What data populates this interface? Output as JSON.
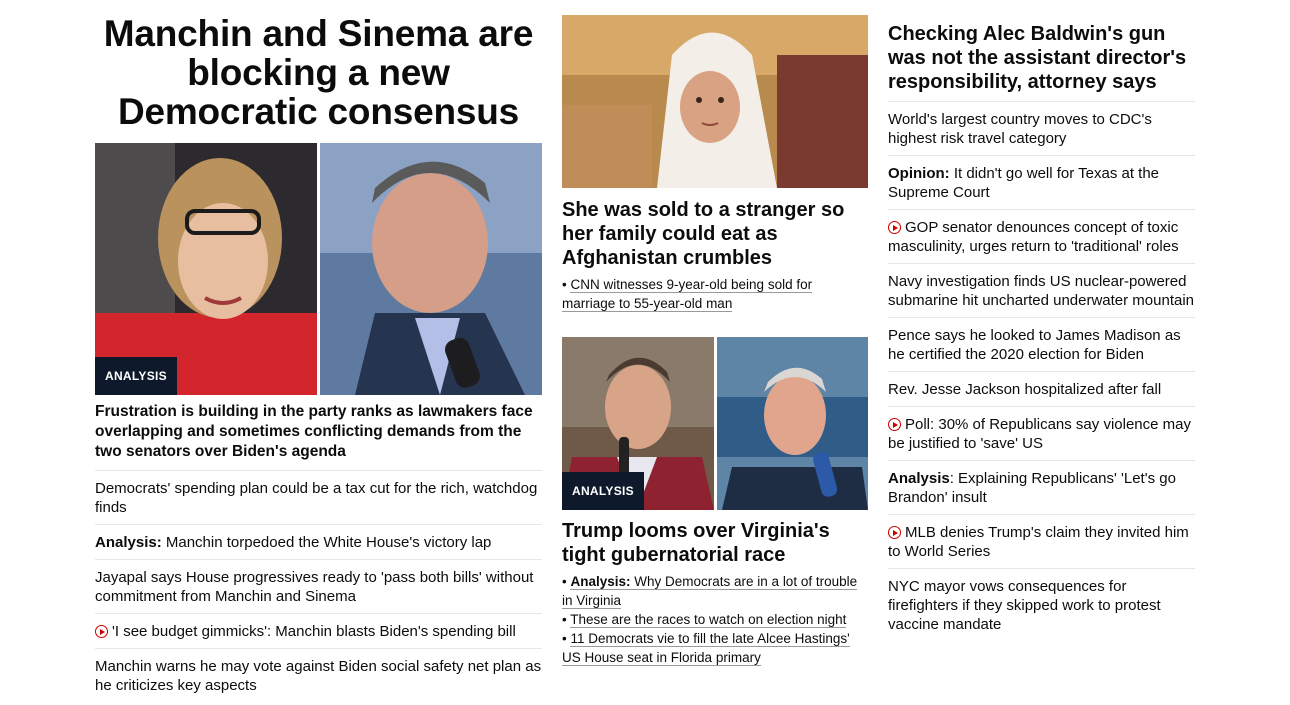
{
  "lead": {
    "headline": "Manchin and Sinema are blocking a new Democratic consensus",
    "badge": "ANALYSIS",
    "subheadline": "Frustration is building in the party ranks as lawmakers face overlapping and sometimes conflicting demands from the two senators over Biden's agenda",
    "links": [
      {
        "prefix": "",
        "text": "Democrats' spending plan could be a tax cut for the rich, watchdog finds",
        "video": false
      },
      {
        "prefix": "Analysis:",
        "text": " Manchin torpedoed the White House's victory lap",
        "video": false
      },
      {
        "prefix": "",
        "text": "Jayapal says House progressives ready to 'pass both bills' without commitment from Manchin and Sinema",
        "video": false
      },
      {
        "prefix": "",
        "text": "'I see budget gimmicks': Manchin blasts Biden's spending bill",
        "video": true
      },
      {
        "prefix": "",
        "text": "Manchin warns he may vote against Biden social safety net plan as he criticizes key aspects",
        "video": false
      }
    ]
  },
  "afghan": {
    "headline": "She was sold to a stranger so her family could eat as Afghanistan crumbles",
    "bullets": [
      {
        "prefix": "",
        "text": "CNN witnesses 9-year-old being sold for marriage to 55-year-old man"
      }
    ]
  },
  "virginia": {
    "badge": "ANALYSIS",
    "headline": "Trump looms over Virginia's tight gubernatorial race",
    "bullets": [
      {
        "prefix": "Analysis:",
        "text": " Why Democrats are in a lot of trouble in Virginia"
      },
      {
        "prefix": "",
        "text": "These are the races to watch on election night"
      },
      {
        "prefix": "",
        "text": "11 Democrats vie to fill the late Alcee Hastings' US House seat in Florida primary"
      }
    ]
  },
  "right": {
    "headline": "Checking Alec Baldwin's gun was not the assistant director's responsibility, attorney says",
    "links": [
      {
        "prefix": "",
        "text": "World's largest country moves to CDC's highest risk travel category",
        "video": false
      },
      {
        "prefix": "Opinion:",
        "text": " It didn't go well for Texas at the Supreme Court",
        "video": false
      },
      {
        "prefix": "",
        "text": "GOP senator denounces concept of toxic masculinity, urges return to 'traditional' roles",
        "video": true
      },
      {
        "prefix": "",
        "text": "Navy investigation finds US nuclear-powered submarine hit uncharted underwater mountain",
        "video": false
      },
      {
        "prefix": "",
        "text": "Pence says he looked to James Madison as he certified the 2020 election for Biden",
        "video": false
      },
      {
        "prefix": "",
        "text": "Rev. Jesse Jackson hospitalized after fall",
        "video": false
      },
      {
        "prefix": "",
        "text": "Poll: 30% of Republicans say violence may be justified to 'save' US",
        "video": true
      },
      {
        "prefix": "Analysis",
        "text": ": Explaining Republicans' 'Let's go Brandon' insult",
        "video": false
      },
      {
        "prefix": "",
        "text": "MLB denies Trump's claim they invited him to World Series",
        "video": true
      },
      {
        "prefix": "",
        "text": "NYC mayor vows consequences for firefighters if they skipped work to protest vaccine mandate",
        "video": false
      }
    ]
  },
  "colors": {
    "badge_bg": "#0e1a2b",
    "video_red": "#cc0000",
    "divider": "#e6e6e6"
  }
}
